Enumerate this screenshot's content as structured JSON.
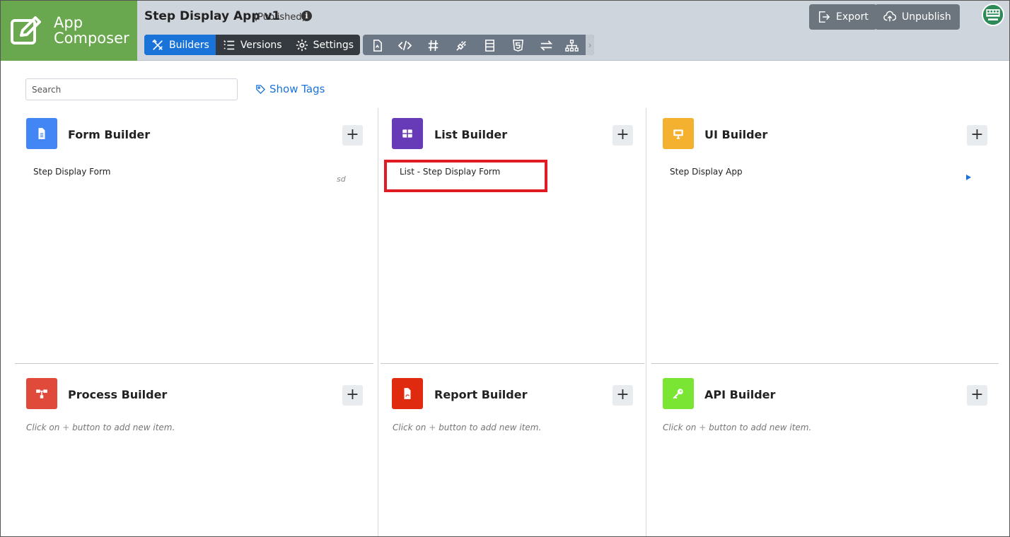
{
  "brand": {
    "line1": "App",
    "line2": "Composer",
    "color": "#6aa84f"
  },
  "app": {
    "title": "Step Display App v1",
    "status": "(Published)"
  },
  "nav_tabs": [
    {
      "label": "Builders",
      "icon": "builders-icon",
      "active": true
    },
    {
      "label": "Versions",
      "icon": "list-icon",
      "active": false
    },
    {
      "label": "Settings",
      "icon": "gear-icon",
      "active": false
    }
  ],
  "tools": [
    "file-icon",
    "code-icon",
    "hash-icon",
    "plug-icon",
    "table-icon",
    "html5-icon",
    "exchange-icon",
    "sitemap-icon"
  ],
  "header_buttons": {
    "export": "Export",
    "unpublish": "Unpublish"
  },
  "search": {
    "placeholder": "Search",
    "value": ""
  },
  "show_tags": "Show Tags",
  "builders": {
    "form": {
      "title": "Form Builder",
      "color": "#4285f4",
      "items": [
        {
          "label": "Step Display Form",
          "tag": "sd"
        }
      ]
    },
    "list": {
      "title": "List Builder",
      "color": "#673ab7",
      "items": [
        {
          "label": "List - Step Display Form"
        }
      ]
    },
    "ui": {
      "title": "UI Builder",
      "color": "#f4b130",
      "items": [
        {
          "label": "Step Display App"
        }
      ]
    },
    "process": {
      "title": "Process Builder",
      "color": "#e04a3b",
      "hint_before": "Click on",
      "hint_after": "button to add new item."
    },
    "report": {
      "title": "Report Builder",
      "color": "#e02a10",
      "hint_before": "Click on",
      "hint_after": "button to add new item."
    },
    "api": {
      "title": "API Builder",
      "color": "#7be534",
      "hint_before": "Click on",
      "hint_after": "button to add new item."
    }
  },
  "colors": {
    "accent": "#1a73d9",
    "highlight": "#e01b24"
  }
}
